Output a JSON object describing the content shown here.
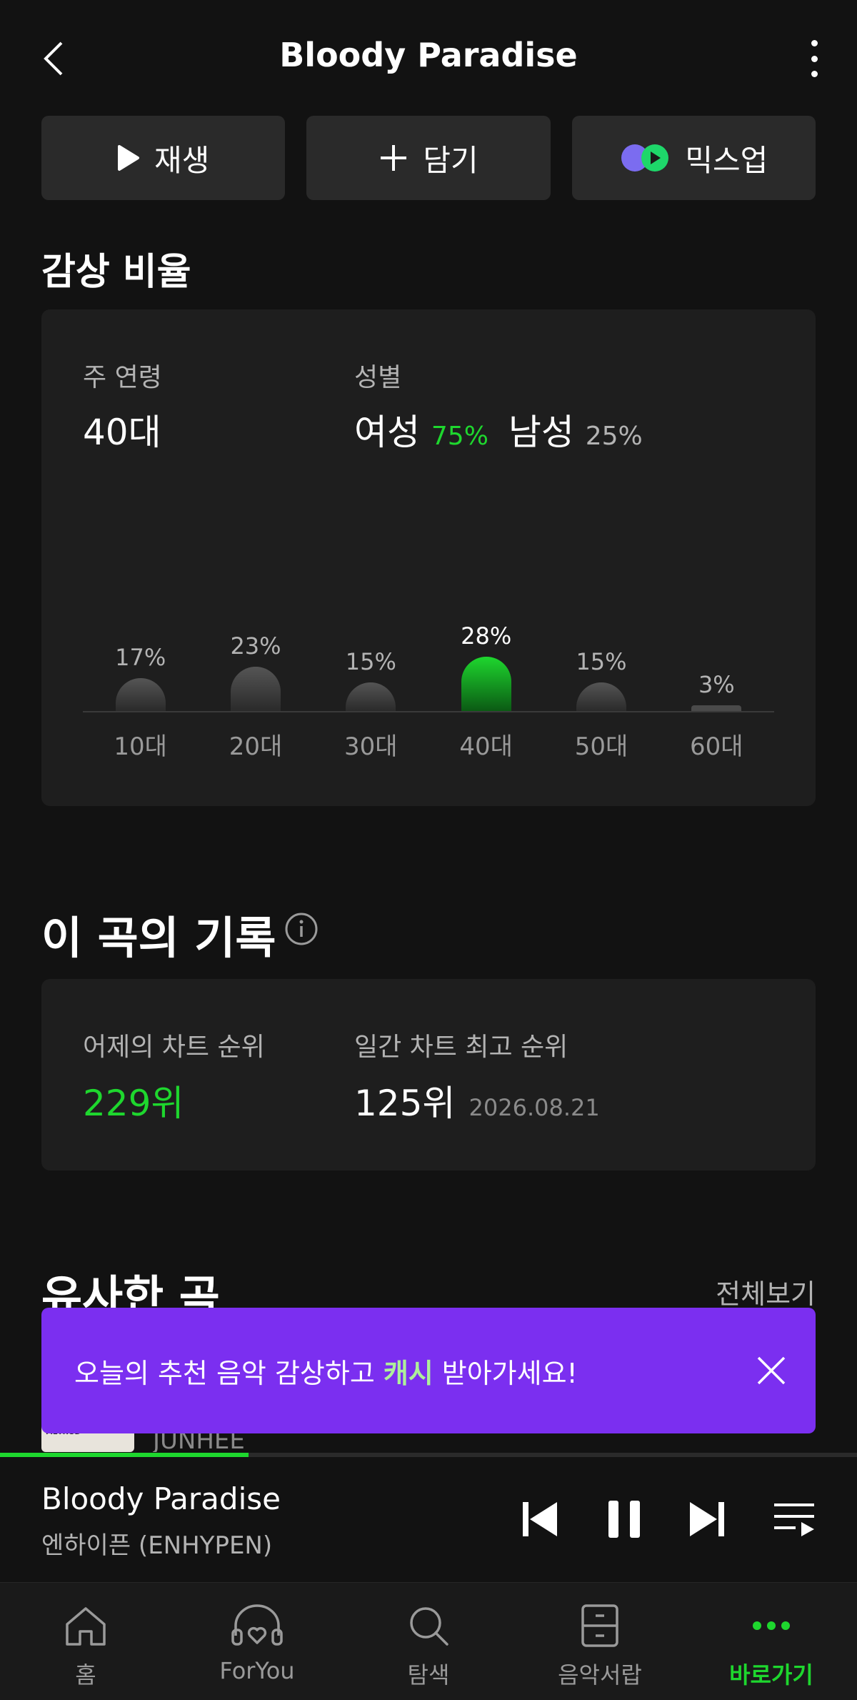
{
  "header": {
    "title": "Bloody Paradise"
  },
  "actions": [
    {
      "label": "재생",
      "icon": "play-icon"
    },
    {
      "label": "담기",
      "icon": "plus-icon"
    },
    {
      "label": "믹스업",
      "icon": "mixup-icon"
    }
  ],
  "listening": {
    "section_title": "감상 비율",
    "main_age_label": "주 연령",
    "main_age_value": "40대",
    "gender_label": "성별",
    "female_label": "여성",
    "female_pct": "75%",
    "male_label": "남성",
    "male_pct": "25%"
  },
  "chart_data": {
    "type": "bar",
    "categories": [
      "10대",
      "20대",
      "30대",
      "40대",
      "50대",
      "60대"
    ],
    "values": [
      17,
      23,
      15,
      28,
      15,
      3
    ],
    "value_labels": [
      "17%",
      "23%",
      "15%",
      "28%",
      "15%",
      "3%"
    ],
    "highlight": "40대",
    "highlight_color": "#1ed72e",
    "ylim": [
      0,
      30
    ]
  },
  "records": {
    "section_title": "이 곡의 기록",
    "yesterday_label": "어제의 차트 순위",
    "yesterday_value": "229위",
    "best_label": "일간 차트 최고 순위",
    "best_value": "125위",
    "best_date": "2026.08.21"
  },
  "similar": {
    "section_title": "유사한 곡",
    "view_all": "전체보기",
    "cover_text": "JUNHEE LOVE METHOD",
    "artist_partial": "JUNHEE"
  },
  "toast": {
    "text_before": "오늘의 추천 음악 감상하고",
    "highlight": "캐시",
    "text_after": "받아가세요!"
  },
  "player": {
    "title": "Bloody Paradise",
    "artist": "엔하이픈 (ENHYPEN)",
    "progress": 0.29
  },
  "nav": [
    {
      "label": "홈",
      "icon": "home-icon",
      "active": false
    },
    {
      "label": "ForYou",
      "icon": "headphones-heart-icon",
      "active": false
    },
    {
      "label": "탐색",
      "icon": "search-icon",
      "active": false
    },
    {
      "label": "음악서랍",
      "icon": "drawer-icon",
      "active": false
    },
    {
      "label": "바로가기",
      "icon": "more-dots-icon",
      "active": true
    }
  ],
  "colors": {
    "accent": "#1ed72e",
    "background": "#121212",
    "card": "#1e1e1e",
    "toast": "#7b2ff0"
  }
}
